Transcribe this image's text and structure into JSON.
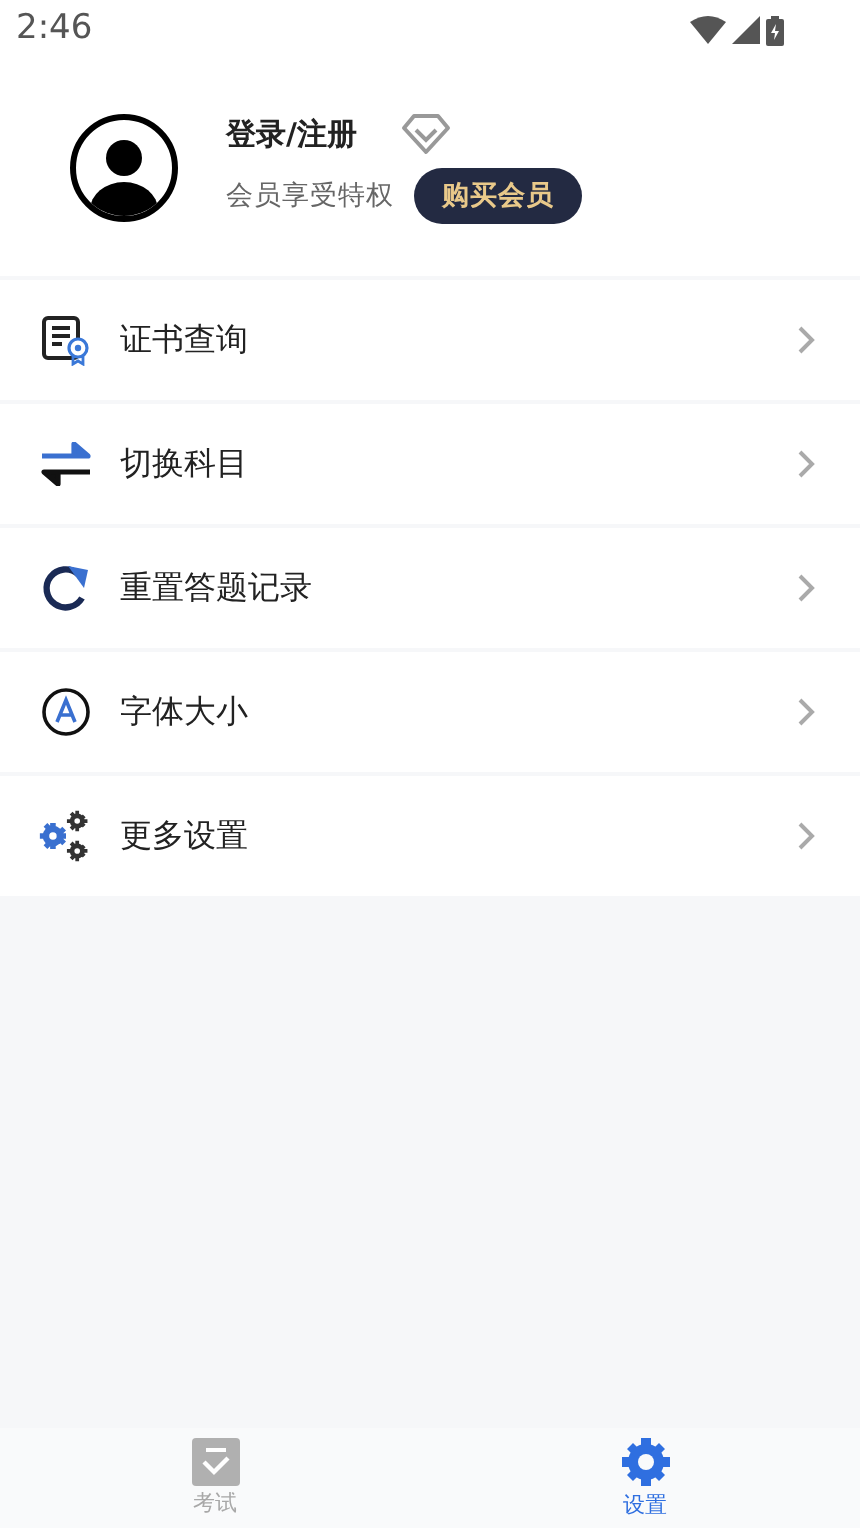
{
  "status_bar": {
    "time": "2:46"
  },
  "profile": {
    "name": "登录/注册",
    "subtitle": "会员享受特权",
    "button": "购买会员"
  },
  "menu": [
    {
      "label": "证书查询"
    },
    {
      "label": "切换科目"
    },
    {
      "label": "重置答题记录"
    },
    {
      "label": "字体大小"
    },
    {
      "label": "更多设置"
    }
  ],
  "tabs": [
    {
      "label": "考试",
      "selected": false
    },
    {
      "label": "设置",
      "selected": true
    }
  ]
}
